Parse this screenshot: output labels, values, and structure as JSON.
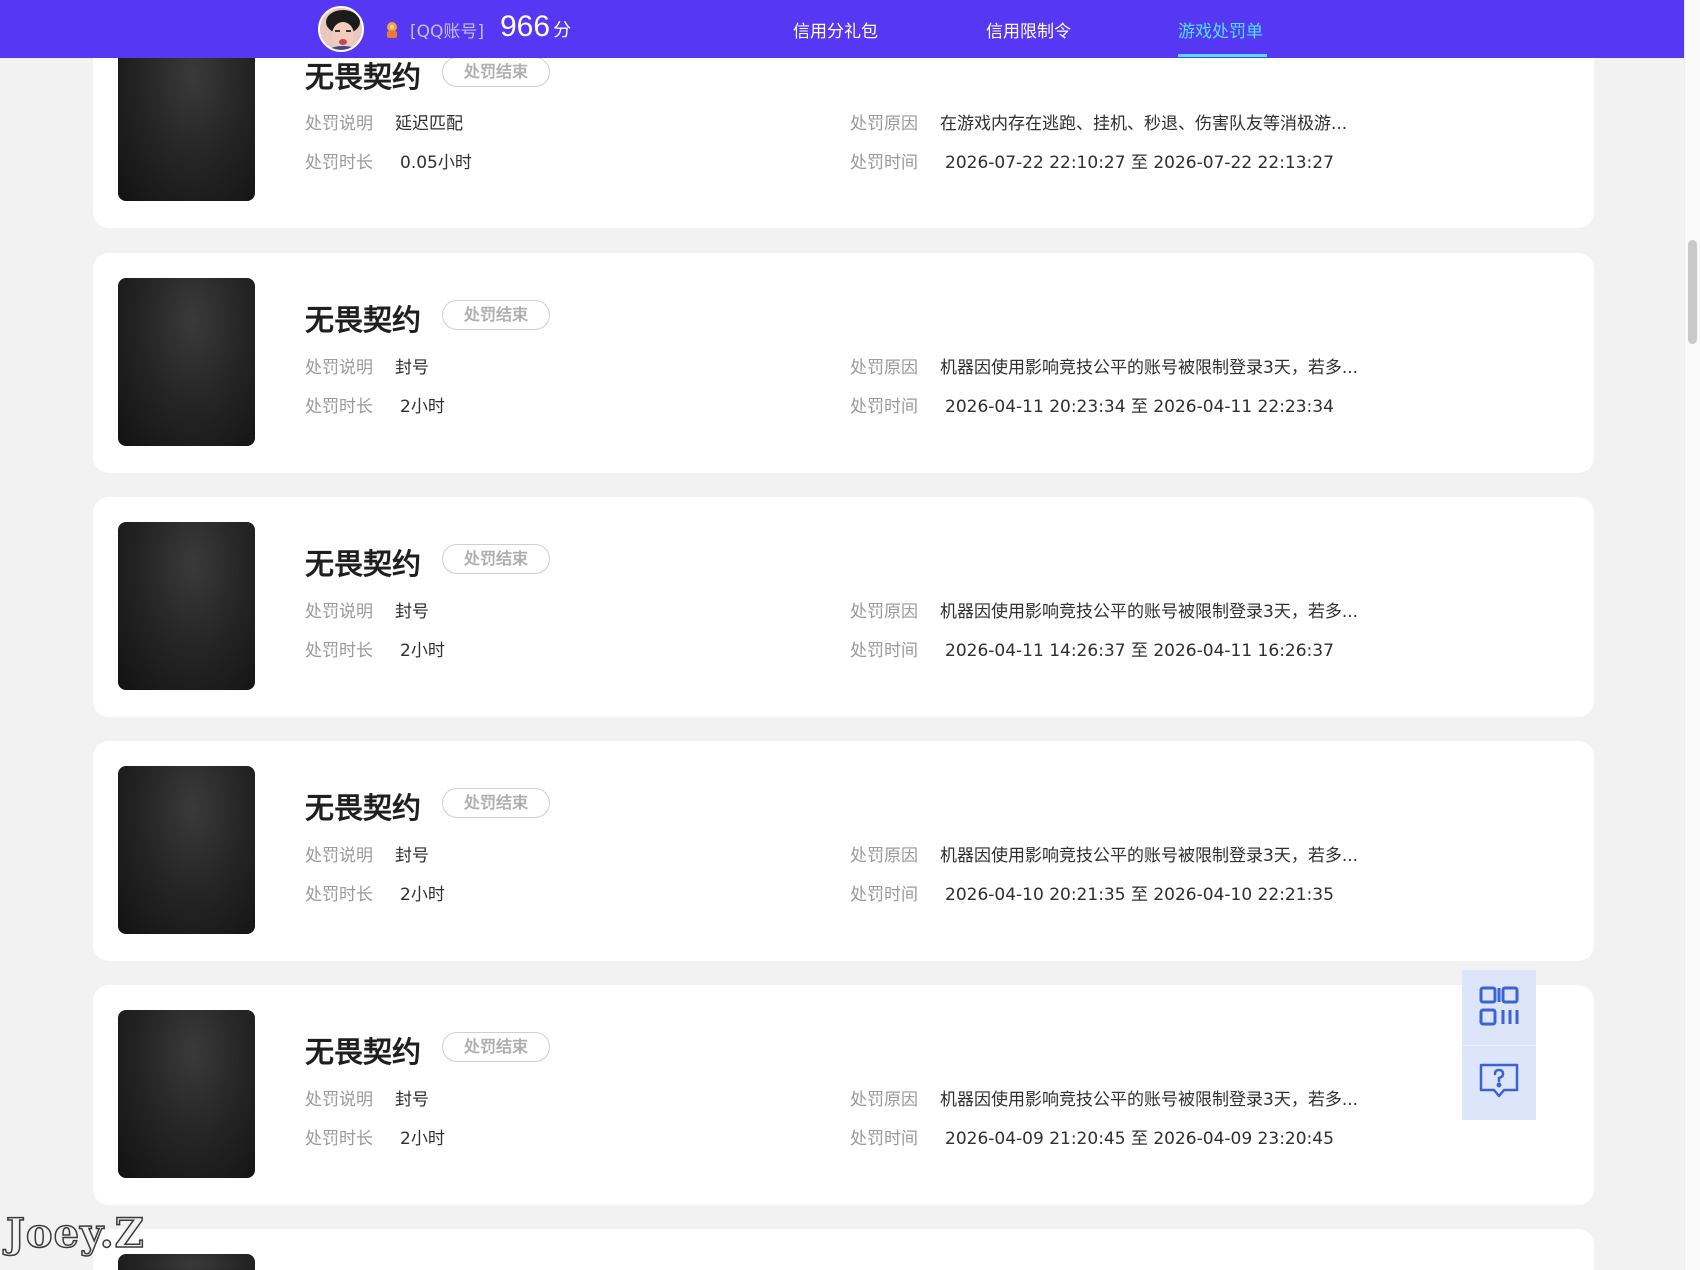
{
  "header": {
    "account_label": "[QQ账号]",
    "score": "966",
    "score_unit": "分",
    "nav": [
      "信用分礼包",
      "信用限制令",
      "游戏处罚单"
    ],
    "active_nav": "游戏处罚单",
    "colors": {
      "bar": "#5537f4",
      "active": "#4fe3ff"
    }
  },
  "labels": {
    "desc": "处罚说明",
    "duration": "处罚时长",
    "reason": "处罚原因",
    "time": "处罚时间"
  },
  "records": [
    {
      "game": "无畏契约",
      "status": "处罚结束",
      "desc": "延迟匹配",
      "duration": "0.05小时",
      "reason": "在游戏内存在逃跑、挂机、秒退、伤害队友等消极游...",
      "time": "2026-07-22 22:10:27 至 2026-07-22 22:13:27"
    },
    {
      "game": "无畏契约",
      "status": "处罚结束",
      "desc": "封号",
      "duration": "2小时",
      "reason": "机器因使用影响竞技公平的账号被限制登录3天，若多...",
      "time": "2026-04-11 20:23:34 至 2026-04-11 22:23:34"
    },
    {
      "game": "无畏契约",
      "status": "处罚结束",
      "desc": "封号",
      "duration": "2小时",
      "reason": "机器因使用影响竞技公平的账号被限制登录3天，若多...",
      "time": "2026-04-11 14:26:37 至 2026-04-11 16:26:37"
    },
    {
      "game": "无畏契约",
      "status": "处罚结束",
      "desc": "封号",
      "duration": "2小时",
      "reason": "机器因使用影响竞技公平的账号被限制登录3天，若多...",
      "time": "2026-04-10 20:21:35 至 2026-04-10 22:21:35"
    },
    {
      "game": "无畏契约",
      "status": "处罚结束",
      "desc": "封号",
      "duration": "2小时",
      "reason": "机器因使用影响竞技公平的账号被限制登录3天，若多...",
      "time": "2026-04-09 21:20:45 至 2026-04-09 23:20:45"
    }
  ],
  "float_buttons": [
    "qr-code-icon",
    "help-chat-icon"
  ],
  "watermark": "Joey.Z"
}
